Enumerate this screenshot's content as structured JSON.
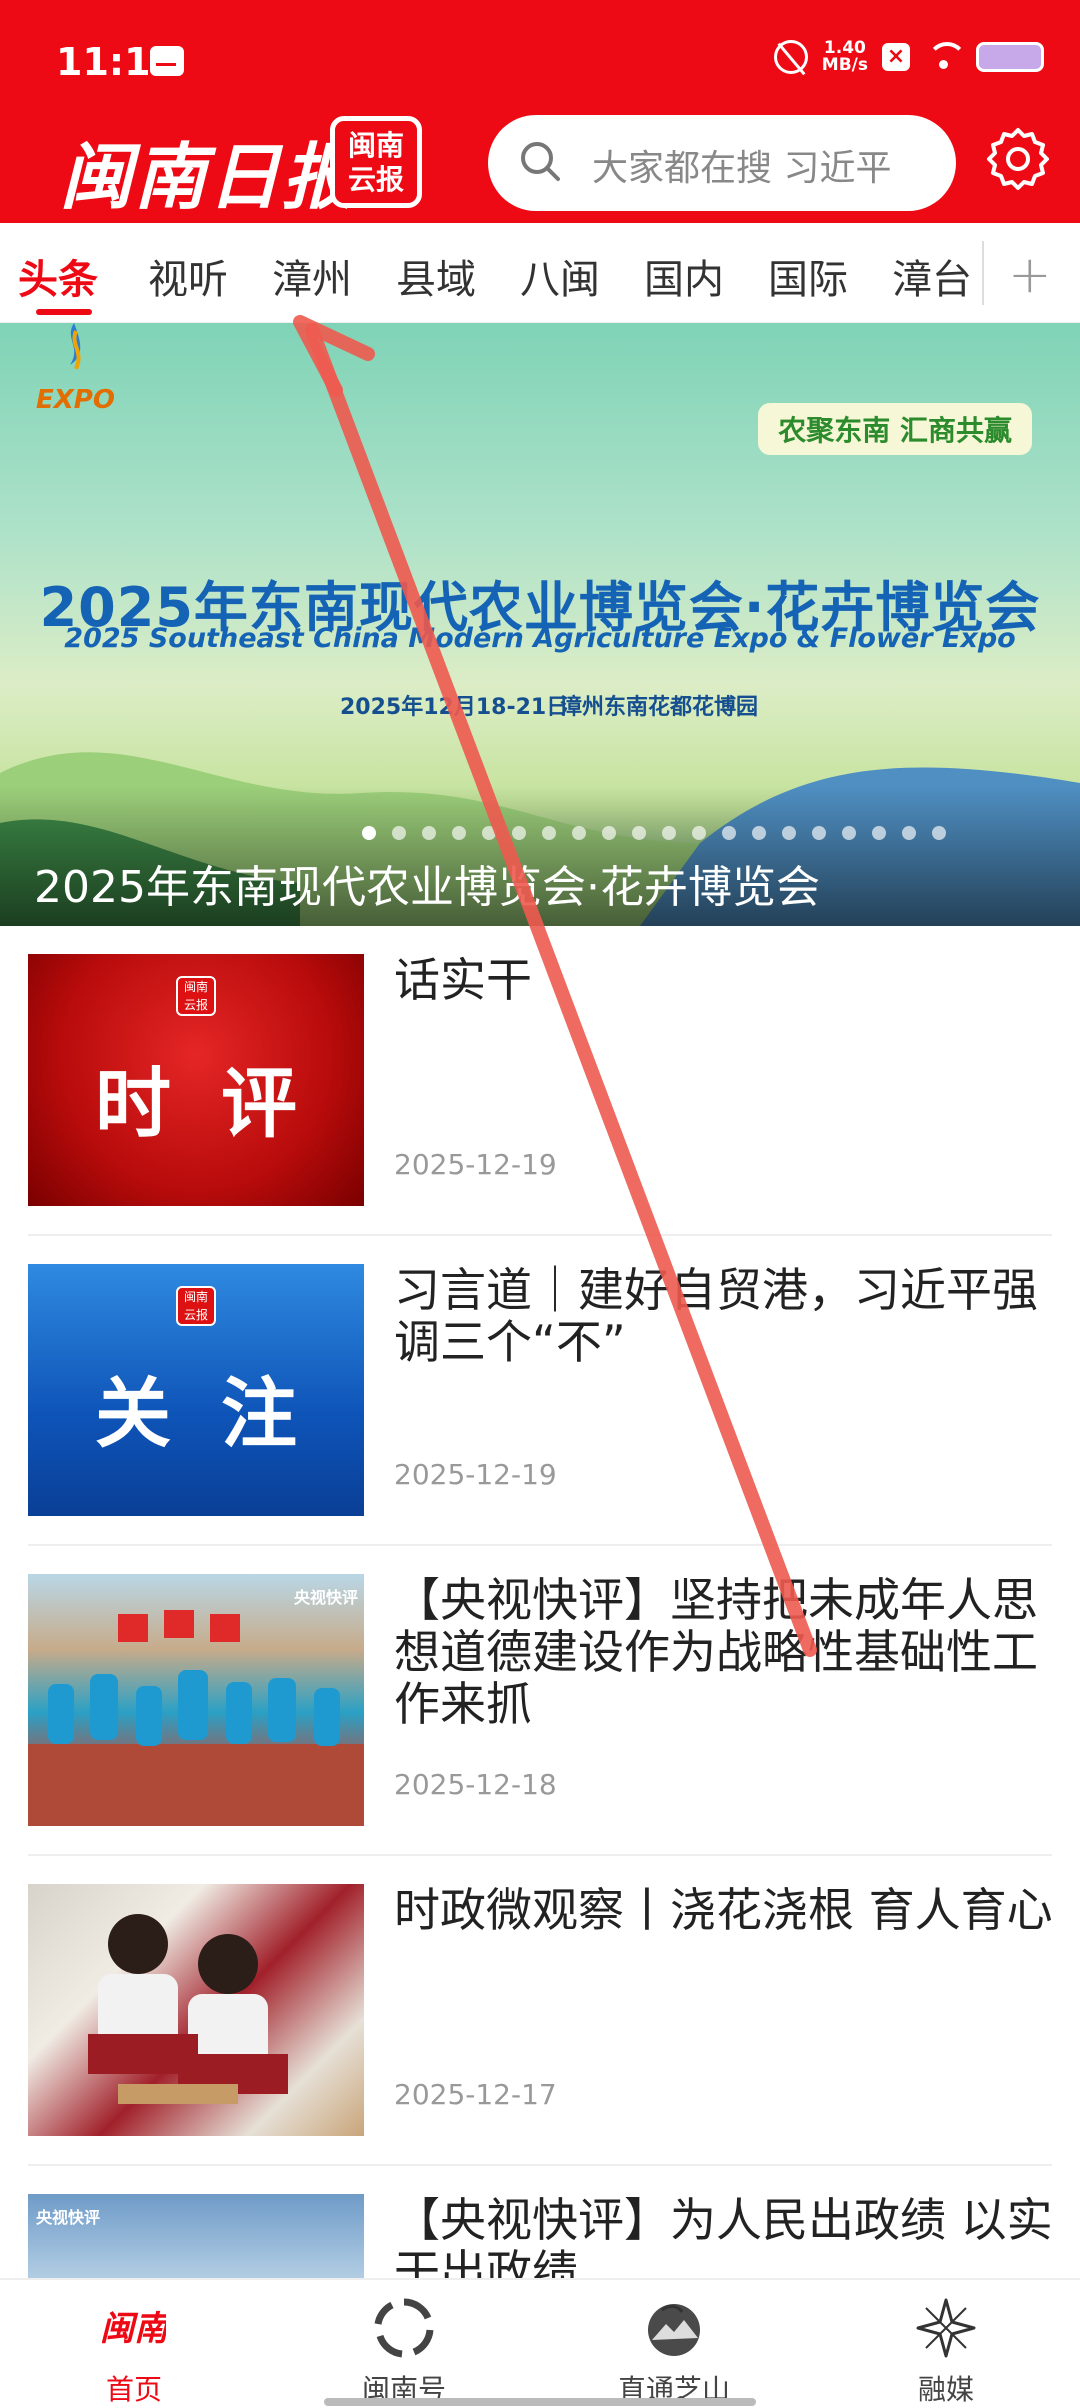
{
  "status_bar": {
    "time": "11:18",
    "net_speed_value": "1.40",
    "net_speed_unit": "MB/s"
  },
  "header": {
    "logo_text": "闽南日报",
    "logo_badge": "闽南\n云报",
    "search_placeholder": "大家都在搜 习近平"
  },
  "tabs": [
    {
      "label": "头条",
      "active": true
    },
    {
      "label": "视听",
      "active": false
    },
    {
      "label": "漳州",
      "active": false
    },
    {
      "label": "县域",
      "active": false
    },
    {
      "label": "八闽",
      "active": false
    },
    {
      "label": "国内",
      "active": false
    },
    {
      "label": "国际",
      "active": false
    },
    {
      "label": "漳台",
      "active": false
    }
  ],
  "tab_plus": "+",
  "banner": {
    "expo_logo": "EXPO",
    "slogan": "农聚东南  汇商共赢",
    "title_cn": "2025年东南现代农业博览会·花卉博览会",
    "title_en": "2025 Southeast China Modern Agriculture Expo & Flower Expo",
    "date": "2025年12月18-21日",
    "place": "漳州东南花都花博园",
    "caption": "2025年东南现代农业博览会·花卉博览会",
    "active_slide": 1,
    "slide_count": 20
  },
  "news": [
    {
      "title": "话实干",
      "date": "2025-12-19",
      "thumb_word": "时评",
      "thumb_badge": "闽南云报"
    },
    {
      "title": "习言道｜建好自贸港，习近平强调三个“不”",
      "date": "2025-12-19",
      "thumb_word": "关注",
      "thumb_badge": "闽南云报"
    },
    {
      "title": "【央视快评】坚持把未成年人思想道德建设作为战略性基础性工作来抓",
      "date": "2025-12-18",
      "thumb_caption": "央视快评"
    },
    {
      "title": "时政微观察丨浇花浇根 育人育心",
      "date": "2025-12-17"
    },
    {
      "title": "【央视快评】为人民出政绩 以实干出政绩",
      "date": "",
      "thumb_caption": "央视快评"
    }
  ],
  "bottom_nav": [
    {
      "label": "首页",
      "icon": "minnan-logo-icon",
      "active": true
    },
    {
      "label": "闽南号",
      "icon": "refresh-circle-icon",
      "active": false
    },
    {
      "label": "直通芝山",
      "icon": "mountain-icon",
      "active": false
    },
    {
      "label": "融媒",
      "icon": "star-burst-icon",
      "active": false
    }
  ],
  "colors": {
    "brand_red": "#ee0a14",
    "gesture_arrow": "#ee5a4f"
  }
}
